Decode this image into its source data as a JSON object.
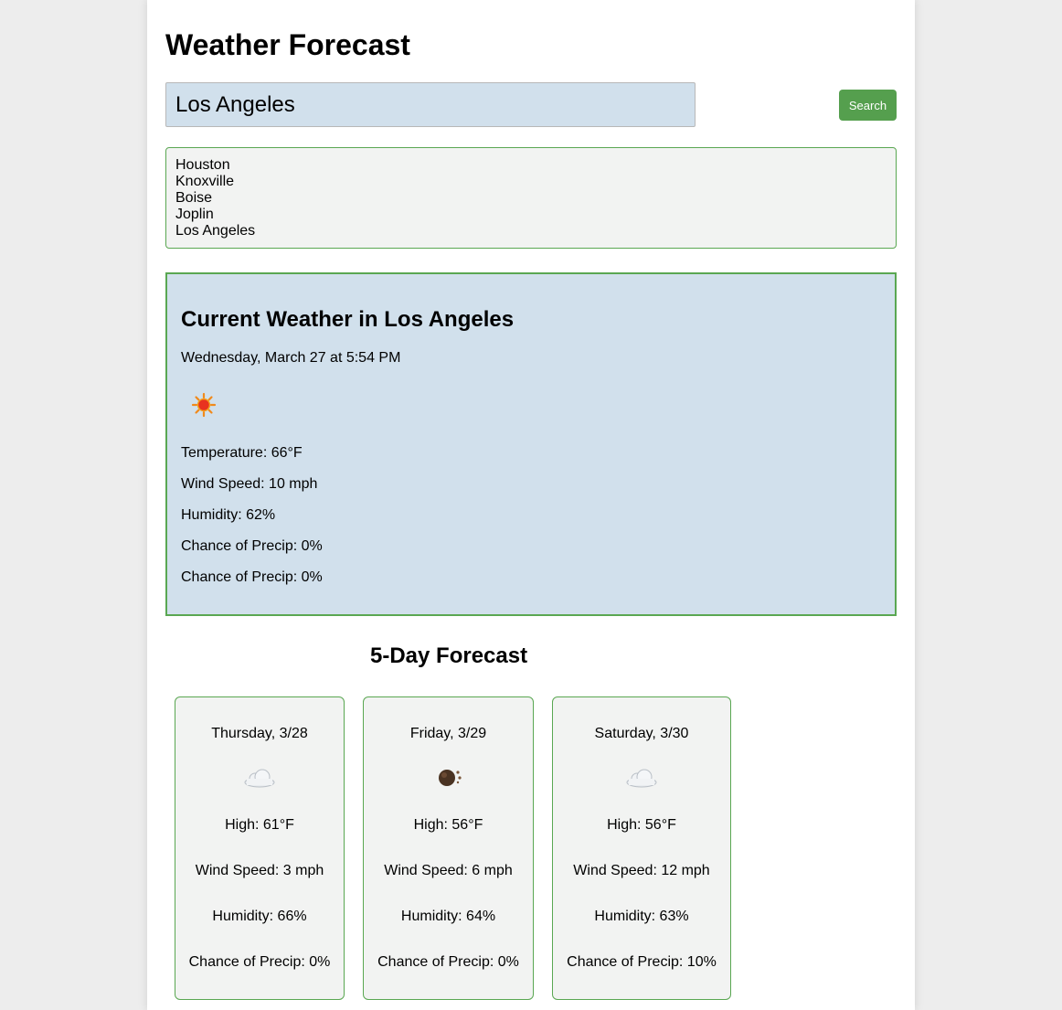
{
  "header": {
    "title": "Weather Forecast"
  },
  "search": {
    "value": "Los Angeles",
    "button_label": "Search"
  },
  "history": [
    "Houston",
    "Knoxville",
    "Boise",
    "Joplin",
    "Los Angeles"
  ],
  "current": {
    "title": "Current Weather in Los Angeles",
    "date": "Wednesday, March 27 at 5:54 PM",
    "icon": "sun-icon",
    "temperature": "Temperature: 66°F",
    "wind": "Wind Speed: 10 mph",
    "humidity": "Humidity: 62%",
    "precip_1": "Chance of Precip: 0%",
    "precip_2": "Chance of Precip: 0%"
  },
  "forecast": {
    "title": "5-Day Forecast",
    "days": [
      {
        "date": "Thursday, 3/28",
        "icon": "cloud-icon",
        "high": "High: 61°F",
        "wind": "Wind Speed: 3 mph",
        "humidity": "Humidity: 66%",
        "precip": "Chance of Precip: 0%"
      },
      {
        "date": "Friday, 3/29",
        "icon": "rain-icon",
        "high": "High: 56°F",
        "wind": "Wind Speed: 6 mph",
        "humidity": "Humidity: 64%",
        "precip": "Chance of Precip: 0%"
      },
      {
        "date": "Saturday, 3/30",
        "icon": "cloud-icon",
        "high": "High: 56°F",
        "wind": "Wind Speed: 12 mph",
        "humidity": "Humidity: 63%",
        "precip": "Chance of Precip: 10%"
      }
    ]
  },
  "colors": {
    "accent_green": "#5aa752",
    "button_green": "#559f4e",
    "panel_blue": "#d1e0ec",
    "panel_gray": "#f2f3f2",
    "page_bg": "#ededed"
  }
}
